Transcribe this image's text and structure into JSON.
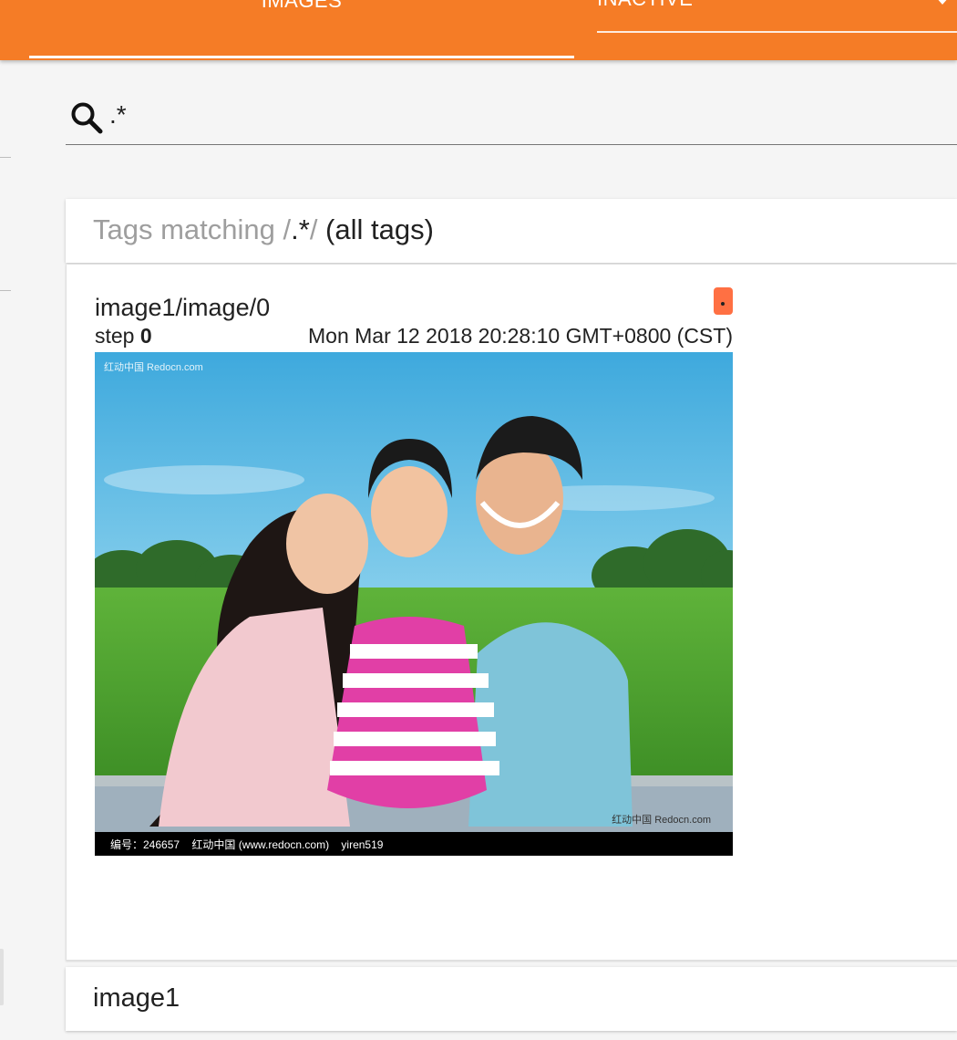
{
  "topbar": {
    "active_tab_label": "IMAGES",
    "run_select_value": "INACTIVE",
    "brand_color": "#f57c26"
  },
  "search": {
    "value": ".*",
    "icon": "search-icon"
  },
  "tags_header": {
    "prefix": "Tags matching ",
    "slash_open": "/",
    "regex": ".*",
    "slash_close": "/",
    "suffix": " (all tags)"
  },
  "image_card": {
    "tag": "image1/image/0",
    "step_label": "step ",
    "step_value": "0",
    "wall_time": "Mon Mar 12 2018 20:28:10 GMT+0800 (CST)",
    "run_color": "#ff7043",
    "run_chip_text": ".",
    "image": {
      "watermark_top": "红动中国 Redocn.com",
      "watermark_bottom": "红动中国 Redocn.com",
      "caption": "编号：246657    红动中国 (www.redocn.com)    yiren519"
    }
  },
  "group": {
    "title": "image1"
  }
}
